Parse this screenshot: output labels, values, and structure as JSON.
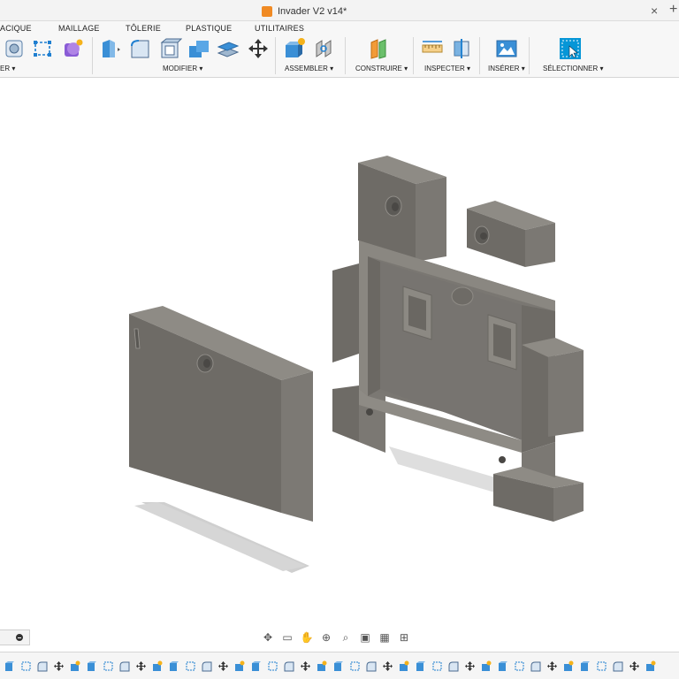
{
  "window": {
    "doc_title": "Invader V2 v14*"
  },
  "ribbon": {
    "tabs": [
      "ACIQUE",
      "MAILLAGE",
      "TÔLERIE",
      "PLASTIQUE",
      "UTILITAIRES"
    ],
    "groups": {
      "create": "ER ▾",
      "modify": "MODIFIER ▾",
      "assemble": "ASSEMBLER ▾",
      "construct": "CONSTRUIRE ▾",
      "inspect": "INSPECTER ▾",
      "insert": "INSÉRER ▾",
      "select": "SÉLECTIONNER ▾"
    }
  },
  "nav_icons": [
    "orbit-icon",
    "look-at-icon",
    "pan-icon",
    "zoom-window-icon",
    "zoom-icon",
    "display-settings-icon",
    "grid-icon",
    "viewports-icon"
  ],
  "timeline": {
    "feature_count": 40
  },
  "colors": {
    "accent": "#0696d7",
    "model_gray": "#777470",
    "selected_tab_bg": "#e8e8e8",
    "ribbon_bg": "#f7f7f7"
  }
}
